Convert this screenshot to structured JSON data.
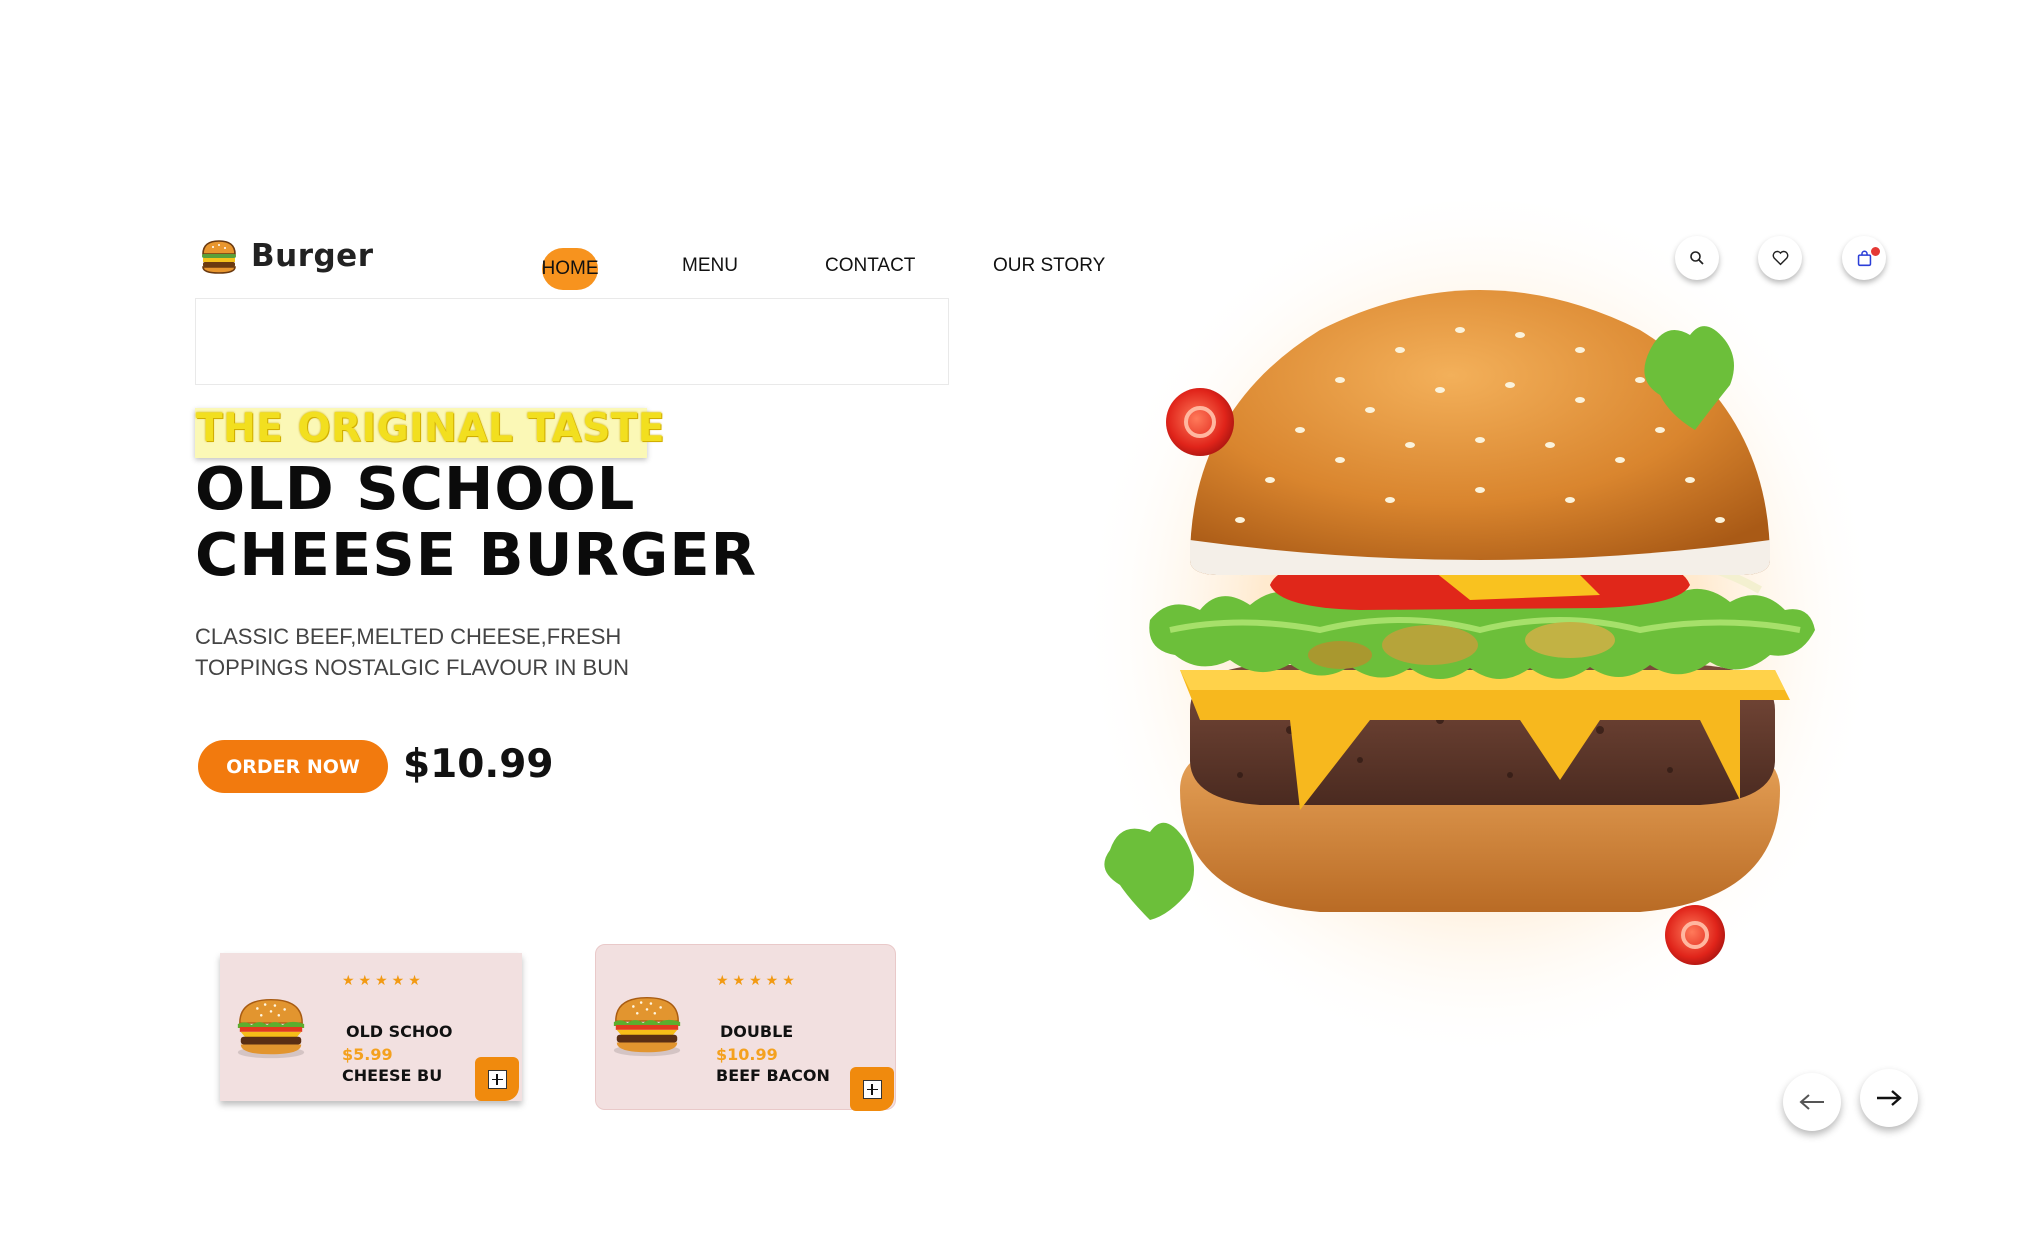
{
  "brand": {
    "name": "Burger",
    "icon": "burger-icon"
  },
  "nav": {
    "home": "HOME",
    "menu": "MENU",
    "contact": "CONTACT",
    "story": "OUR STORY",
    "active": "HOME"
  },
  "header_icons": [
    "search-icon",
    "heart-icon",
    "shopping-bag-icon"
  ],
  "hero": {
    "tagline": "THE ORIGINAL TASTE",
    "title_line1": "OLD SCHOOL",
    "title_line2": "CHEESE BURGER",
    "desc_line1": "CLASSIC BEEF,MELTED CHEESE,FRESH",
    "desc_line2": "TOPPINGS NOSTALGIC FLAVOUR IN BUN",
    "cta": "ORDER NOW",
    "price": "$10.99"
  },
  "products": [
    {
      "stars": "★★★★★",
      "rating": 5,
      "name_line1": "OLD SCHOO",
      "name_line2": "CHEESE BU",
      "price": "$5.99"
    },
    {
      "stars": "★★★★★",
      "rating": 5,
      "name_line1": "DOUBLE",
      "name_line2": "BEEF BACON",
      "price": "$10.99"
    }
  ],
  "carousel": {
    "prev": "arrow-left-icon",
    "next": "arrow-right-icon"
  },
  "colors": {
    "accent": "#f27a0e",
    "nav_active": "#f7931e",
    "card_bg": "#f2e0e0",
    "price": "#f4a11f",
    "tagline": "#f2df1f"
  }
}
